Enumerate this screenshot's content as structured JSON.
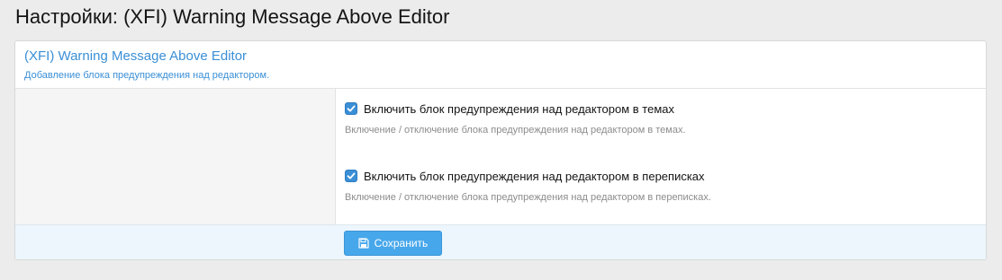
{
  "page": {
    "title": "Настройки: (XFI) Warning Message Above Editor"
  },
  "addon": {
    "title": "(XFI) Warning Message Above Editor",
    "description": "Добавление блока предупреждения над редактором."
  },
  "options": [
    {
      "label": "Включить блок предупреждения над редактором в темах",
      "hint": "Включение / отключение блока предупреждения над редактором в темах.",
      "checked": true
    },
    {
      "label": "Включить блок предупреждения над редактором в переписках",
      "hint": "Включение / отключение блока предупреждения над редактором в переписках.",
      "checked": true
    }
  ],
  "footer": {
    "save_label": "Сохранить",
    "save_icon": "save-icon"
  },
  "colors": {
    "accent": "#47a7eb",
    "link": "#3a8fd6",
    "footer_bg": "#edf6fd"
  }
}
